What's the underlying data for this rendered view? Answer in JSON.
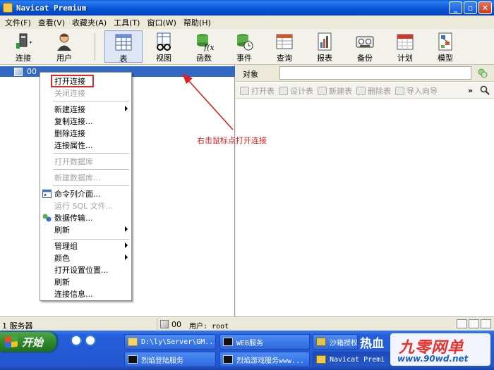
{
  "window": {
    "title": "Navicat Premium"
  },
  "menubar": [
    "文件(F)",
    "查看(V)",
    "收藏夹(A)",
    "工具(T)",
    "窗口(W)",
    "帮助(H)"
  ],
  "toolbar": {
    "connect": "连接",
    "user": "用户",
    "table": "表",
    "view": "视图",
    "function": "函数",
    "event": "事件",
    "query": "查询",
    "report": "报表",
    "backup": "备份",
    "schedule": "计划",
    "model": "模型"
  },
  "tree": {
    "connection_name": "00"
  },
  "object_panel": {
    "tab": "对象",
    "actions": [
      "打开表",
      "设计表",
      "新建表",
      "删除表",
      "导入向导"
    ]
  },
  "context_menu": {
    "items": [
      {
        "label": "打开连接",
        "enabled": true
      },
      {
        "label": "关闭连接",
        "enabled": false
      },
      {
        "label": "新建连接",
        "enabled": true,
        "submenu": true
      },
      {
        "label": "复制连接...",
        "enabled": true
      },
      {
        "label": "删除连接",
        "enabled": true
      },
      {
        "label": "连接属性...",
        "enabled": true
      },
      {
        "label": "打开数据库",
        "enabled": false
      },
      {
        "label": "新建数据库...",
        "enabled": false
      },
      {
        "label": "命令列介面...",
        "enabled": true,
        "icon": "console-icon"
      },
      {
        "label": "运行 SQL 文件...",
        "enabled": false
      },
      {
        "label": "数据传输...",
        "enabled": true,
        "icon": "data-transfer-icon"
      },
      {
        "label": "刷新",
        "enabled": true,
        "submenu": true
      },
      {
        "label": "管理组",
        "enabled": true,
        "submenu": true
      },
      {
        "label": "颜色",
        "enabled": true,
        "submenu": true
      },
      {
        "label": "打开设置位置...",
        "enabled": true
      },
      {
        "label": "刷新",
        "enabled": true
      },
      {
        "label": "连接信息...",
        "enabled": true
      }
    ]
  },
  "annotation": {
    "text": "右击鼠标点打开连接",
    "color": "#e02020"
  },
  "statusbar": {
    "left": "1 服务器",
    "connection": "00",
    "user": "用户: root"
  },
  "taskbar": {
    "start": "开始",
    "buttons": [
      "D:\\ly\\Server\\GM...",
      "WEB服务",
      "沙箱授权",
      "烈焰登陆服务",
      "烈焰游戏服务www...",
      "Navicat Premi"
    ],
    "tray_text": "热血"
  },
  "watermark": {
    "brand": "九零网单",
    "url": "www.90wd.net"
  },
  "colors": {
    "selection": "#316ac5",
    "titlebar": "#0653d6",
    "highlight_box": "#e12626"
  }
}
